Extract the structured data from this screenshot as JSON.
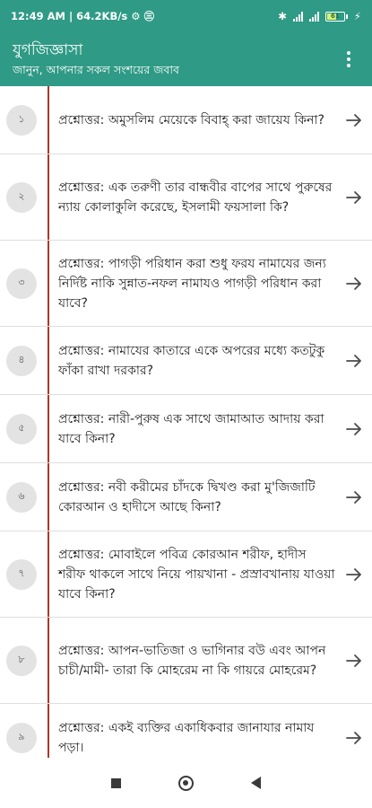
{
  "status_bar": {
    "left_text": "12:49 AM | 64.2KB/s ⚙ ㊂",
    "bluetooth": "✱",
    "battery_level": "61",
    "charging": "⚡"
  },
  "app_bar": {
    "title": "যুগজিজ্ঞাসা",
    "subtitle": "জানুন, আপনার সকল সংশয়ের জবাব"
  },
  "questions": [
    {
      "num": "১",
      "text": "প্রশ্নোত্তর: অমুসলিম মেয়েকে বিবাহ্ করা জায়েয কিনা?"
    },
    {
      "num": "২",
      "text": "প্রশ্নোত্তর: এক তরুণী তার বান্ধবীর বাপের সাথে পুরুষের ন্যায় কোলাকুলি করেছে, ইসলামী ফয়সালা কি?"
    },
    {
      "num": "৩",
      "text": "প্রশ্নোত্তর: পাগড়ী পরিধান করা শুধু ফরয নামাযের জন্য নির্দিষ্ট নাকি সুন্নাত-নফল নামাযও পাগড়ী পরিধান করা যাবে?"
    },
    {
      "num": "৪",
      "text": "প্রশ্নোত্তর: নামাযের কাতারে একে অপরের মধ্যে কতটুকু ফাঁকা রাখা দরকার?"
    },
    {
      "num": "৫",
      "text": "প্রশ্নোত্তর: নারী-পুরুষ এক সাথে জামাআত আদায় করা যাবে কিনা?"
    },
    {
      "num": "৬",
      "text": "প্রশ্নোত্তর: নবী করীমের চাঁদকে দ্বিখণ্ড করা মু'জিজাটি কোরআন ও হাদীসে আছে কিনা?"
    },
    {
      "num": "৭",
      "text": "প্রশ্নোত্তর: মোবাইলে পবিত্র কোরআন শরীফ, হাদীস শরীফ থাকলে সাথে নিয়ে পায়খানা - প্রস্রাবখানায় যাওয়া যাবে কিনা?"
    },
    {
      "num": "৮",
      "text": "প্রশ্নোত্তর: আপন-ভাতিজা ও ভাগিনার বউ এবং আপন চাচী/মামী- তারা কি মোহরেম না কি গায়রে মোহরেম?"
    },
    {
      "num": "৯",
      "text": "প্রশ্নোত্তর: একই ব্যক্তির একাধিকবার জানাযার নামায পড়া।"
    }
  ],
  "icons": {
    "arrow": "arrow-right-icon",
    "menu": "more-vert-icon",
    "nav": [
      "recents-icon",
      "home-icon",
      "back-icon"
    ]
  },
  "colors": {
    "primary": "#2f9a86",
    "divider_accent": "#a83a2a",
    "badge_bg": "#e3e3e3"
  }
}
